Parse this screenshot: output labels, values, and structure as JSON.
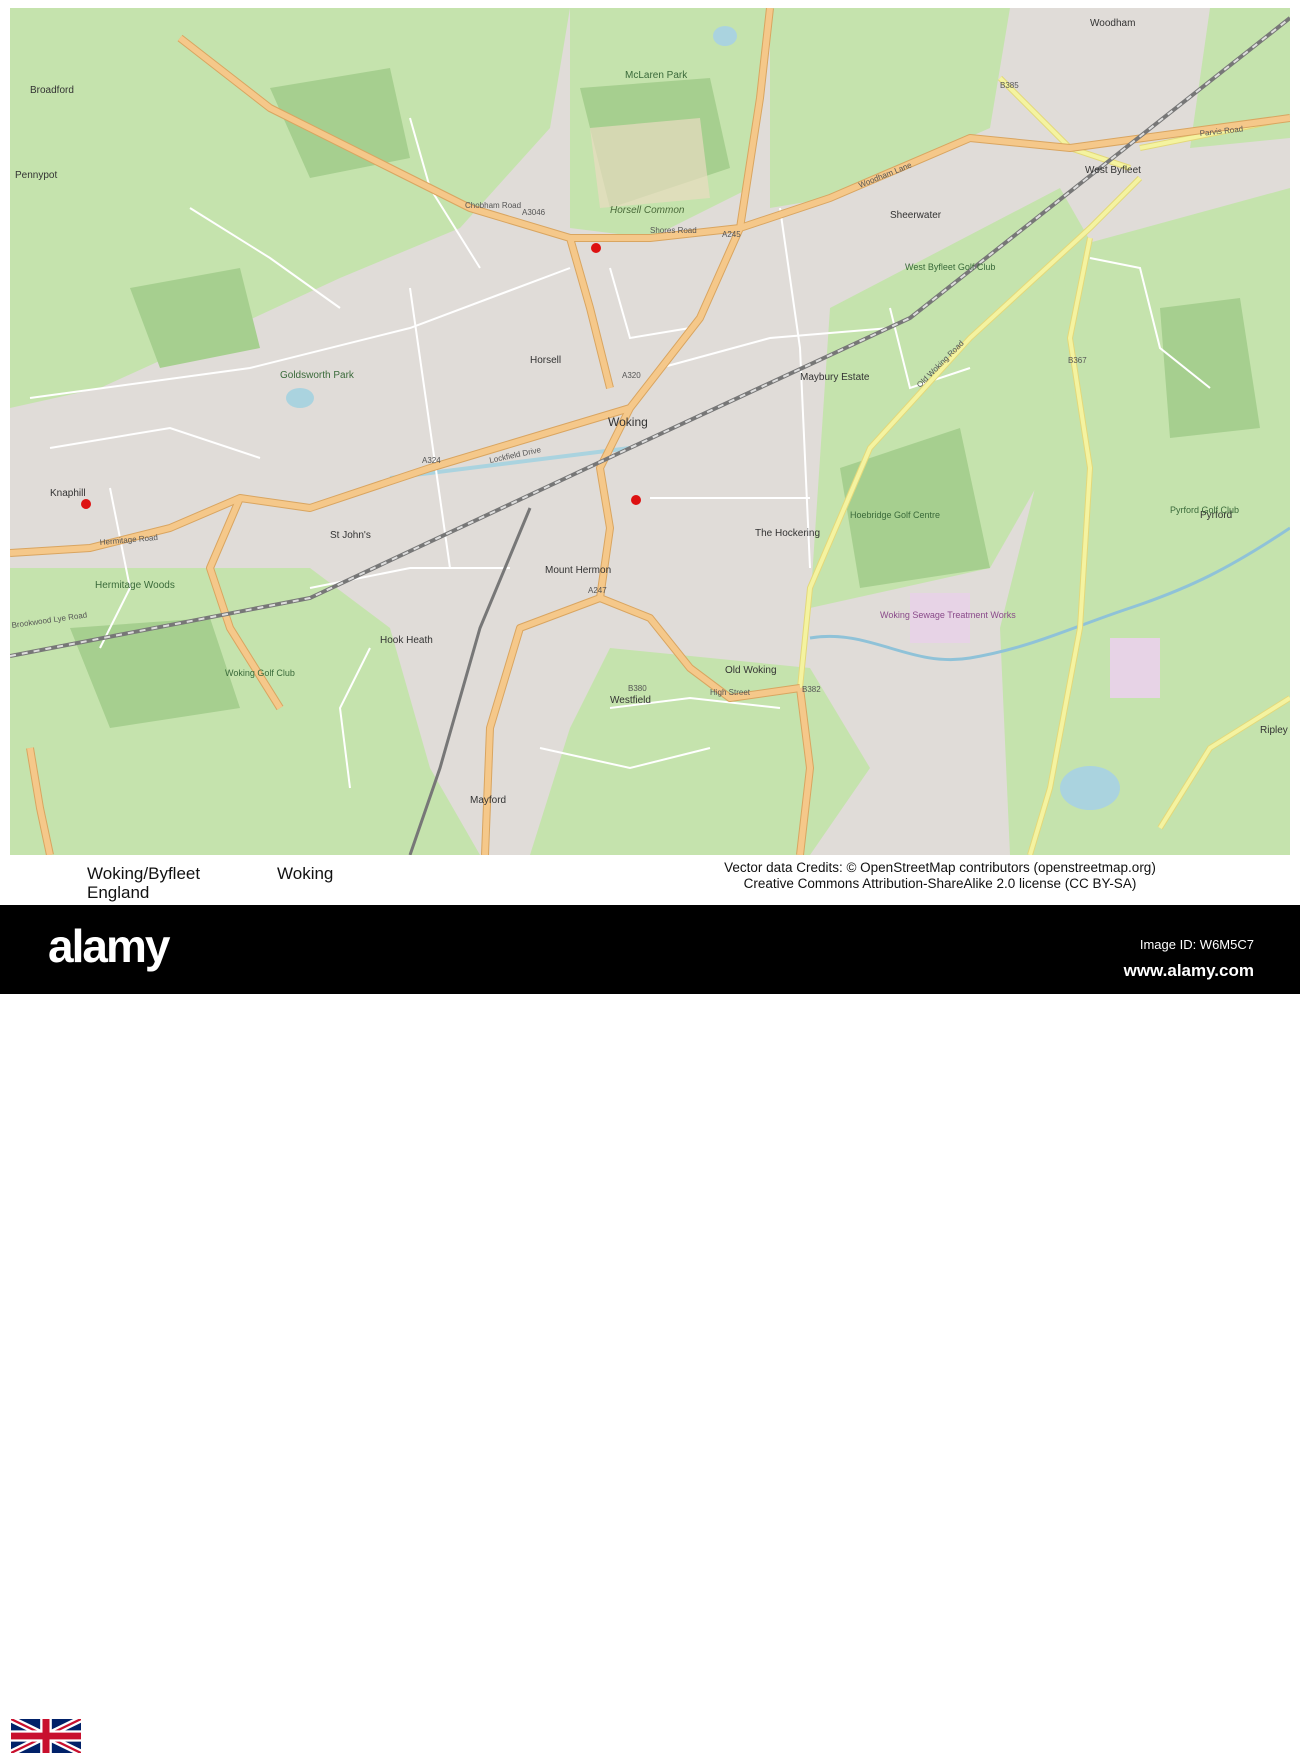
{
  "map": {
    "places": {
      "woking": "Woking",
      "horsell": "Horsell",
      "knaphill": "Knaphill",
      "hook_heath": "Hook Heath",
      "mount_hermon": "Mount Hermon",
      "old_woking": "Old Woking",
      "westfield": "Westfield",
      "mayford": "Mayford",
      "west_byfleet": "West Byfleet",
      "sheerwater": "Sheerwater",
      "pyrford": "Pyrford",
      "ripley": "Ripley",
      "maybury": "Maybury Estate",
      "the_hockering": "The Hockering",
      "horsell_common": "Horsell Common",
      "goldsworth_park": "Goldsworth Park",
      "st_johns": "St John's",
      "woodham": "Woodham",
      "hermitage_woods": "Hermitage Woods",
      "sewage_works": "Woking Sewage Treatment Works",
      "hoebridge_golf": "Hoebridge Golf Centre",
      "woking_golf": "Woking Golf Club",
      "west_byfleet_golf": "West Byfleet Golf Club",
      "pyrford_golf": "Pyrford Golf Club",
      "mclaren_park": "McLaren Park",
      "broadford": "Broadford",
      "pennypot": "Pennypot"
    },
    "roads": {
      "a320": "A320",
      "a324": "A324",
      "a3046": "A3046",
      "a245": "A245",
      "a247": "A247",
      "b380": "B380",
      "b382": "B382",
      "b367": "B367",
      "b385": "B385",
      "chobham_road": "Chobham Road",
      "lockfield_drive": "Lockfield Drive",
      "old_woking_road": "Old Woking Road",
      "shores_road": "Shores Road",
      "woodham_lane": "Woodham Lane",
      "high_street": "High Street",
      "hermitage_road": "Hermitage Road",
      "brookwood_lye_road": "Brookwood Lye Road",
      "parvis_road": "Parvis Road"
    }
  },
  "caption": {
    "region": "Woking/Byfleet",
    "country": "England",
    "city": "Woking",
    "credit_line1": "Vector data Credits: © OpenStreetMap contributors (openstreetmap.org)",
    "credit_line2": "Creative Commons Attribution-ShareAlike 2.0 license (CC BY-SA)"
  },
  "watermark": {
    "logo": "alamy",
    "image_id": "Image ID: W6M5C7",
    "url": "www.alamy.com"
  },
  "colors": {
    "urban": "#e0dcd8",
    "park": "#c8e6b0",
    "wood": "#aed39a",
    "main_road": "#f5c88a",
    "secondary_road": "#f4f3a0",
    "water": "#aad3df"
  }
}
